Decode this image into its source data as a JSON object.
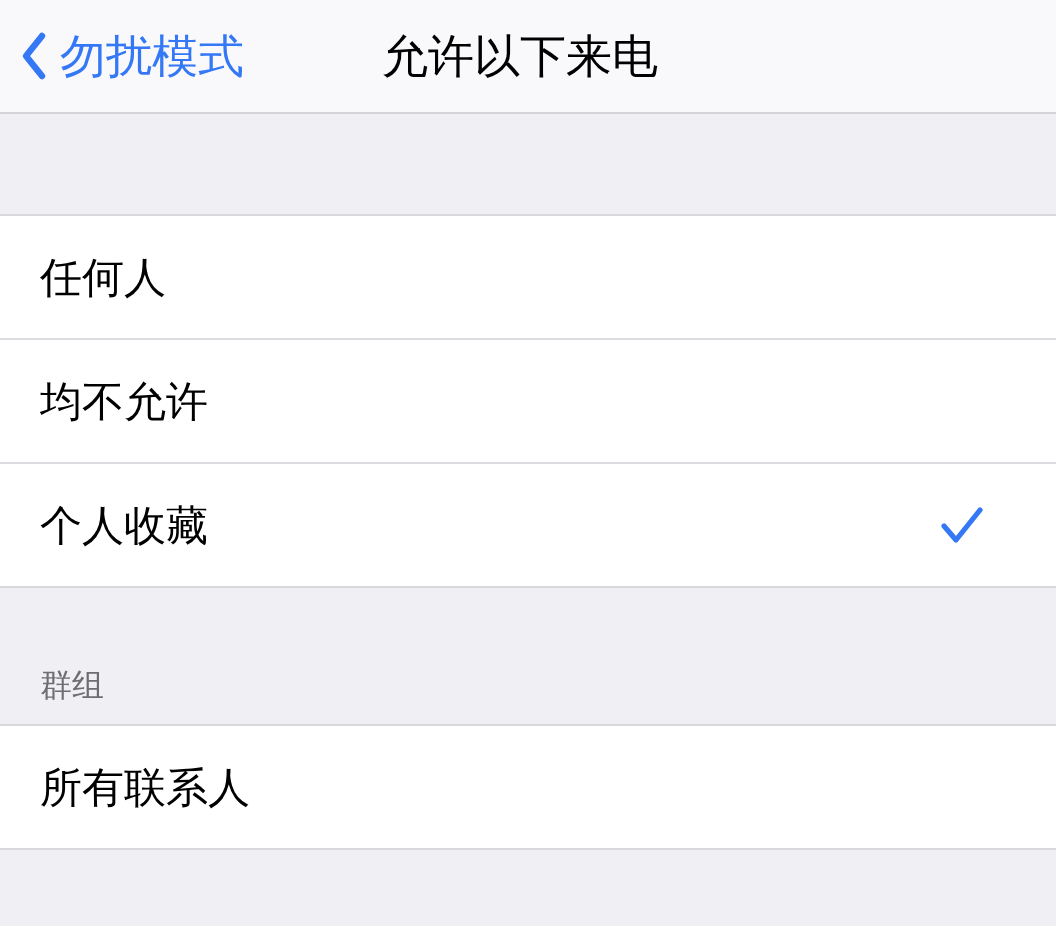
{
  "nav": {
    "back_label": "勿扰模式",
    "title": "允许以下来电"
  },
  "options": [
    {
      "label": "任何人",
      "selected": false
    },
    {
      "label": "均不允许",
      "selected": false
    },
    {
      "label": "个人收藏",
      "selected": true
    }
  ],
  "groups": {
    "header": "群组",
    "items": [
      {
        "label": "所有联系人",
        "selected": false
      }
    ]
  }
}
